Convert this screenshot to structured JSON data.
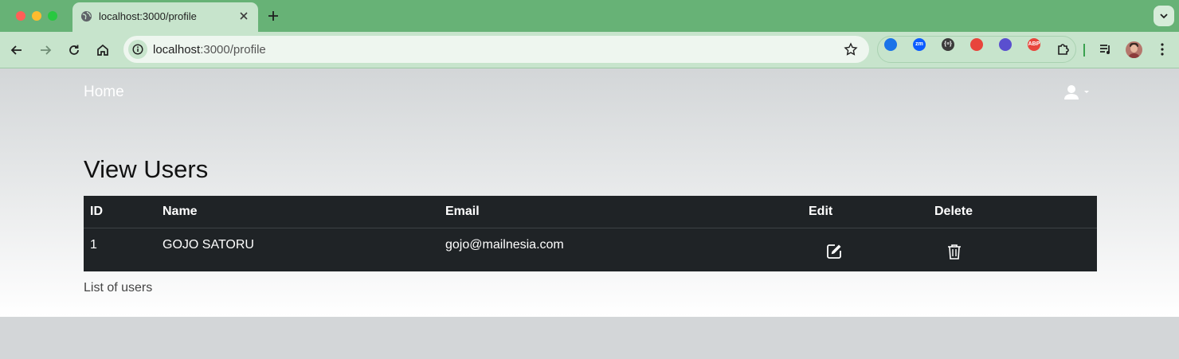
{
  "browser": {
    "tab_title": "localhost:3000/profile",
    "url_host": "localhost",
    "url_path": ":3000/profile",
    "extensions": [
      {
        "name": "s-extension-icon",
        "color": "#1a73e8",
        "label": ""
      },
      {
        "name": "zoom-extension-icon",
        "color": "#0b5cff",
        "label": "zm"
      },
      {
        "name": "json-extension-icon",
        "color": "#3b3b3b",
        "label": "{≡}"
      },
      {
        "name": "color-picker-extension-icon",
        "color": "#e8453c",
        "label": ""
      },
      {
        "name": "mascot-extension-icon",
        "color": "#5a4fcf",
        "label": ""
      },
      {
        "name": "adblock-plus-extension-icon",
        "color": "#e8453c",
        "label": "ABP"
      },
      {
        "name": "extensions-puzzle-icon",
        "color": "#1f1f1f",
        "label": ""
      }
    ]
  },
  "navbar": {
    "brand": "Home"
  },
  "page": {
    "heading": "View Users",
    "caption": "List of users"
  },
  "table": {
    "headers": {
      "id": "ID",
      "name": "Name",
      "email": "Email",
      "edit": "Edit",
      "delete": "Delete"
    },
    "rows": [
      {
        "id": "1",
        "name": "GOJO SATORU",
        "email": "gojo@mailnesia.com"
      }
    ]
  },
  "colors": {
    "tabstrip": "#67b276",
    "table_bg": "#1f2326"
  }
}
